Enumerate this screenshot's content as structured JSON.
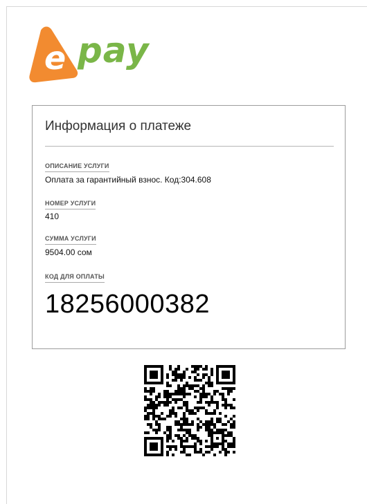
{
  "brand": {
    "logo_text": "pay",
    "logo_letter": "e",
    "colors": {
      "orange": "#f28b30",
      "green": "#7ab648"
    }
  },
  "payment_info": {
    "title": "Информация о платеже",
    "fields": [
      {
        "label": "ОПИСАНИЕ УСЛУГИ",
        "value": "Оплата за гарантийный взнос. Код:304.608"
      },
      {
        "label": "НОМЕР УСЛУГИ",
        "value": "410"
      },
      {
        "label": "СУММА УСЛУГИ",
        "value": "9504.00 сом"
      }
    ],
    "pay_code_label": "КОД ДЛЯ ОПЛАТЫ",
    "pay_code": "18256000382"
  },
  "qr": {
    "icon": "qr-code-icon"
  }
}
